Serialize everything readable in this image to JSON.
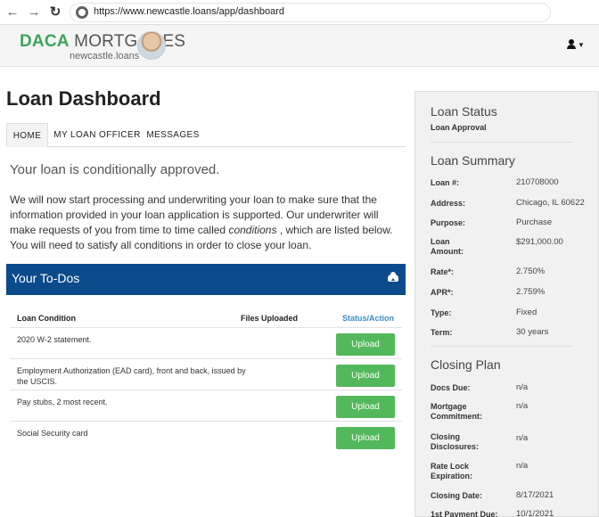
{
  "browser": {
    "url": "https://www.newcastle.loans/app/dashboard"
  },
  "header": {
    "logo_daca": "DACA",
    "logo_mortgages": " MORTGAGES",
    "logo_sub": "newcastle.loans"
  },
  "main": {
    "title": "Loan Dashboard",
    "tabs": [
      "HOME",
      "MY LOAN OFFICER",
      "MESSAGES"
    ],
    "status_line": "Your loan is conditionally approved.",
    "intro_before": "We will now start processing and underwriting your loan to make sure that the information provided in your loan application is supported. Our underwriter will make requests of you from time to time called ",
    "intro_em": "conditions",
    "intro_after": " , which are listed below. You will need to satisfy all conditions in order to close your loan.",
    "todo_title": "Your To-Dos",
    "columns": [
      "Loan Condition",
      "Files Uploaded",
      "Status/Action"
    ],
    "conditions": [
      {
        "text": "2020 W-2 statement.",
        "action": "Upload"
      },
      {
        "text": "Employment Authorization (EAD card), front and back, issued by the USCIS.",
        "action": "Upload"
      },
      {
        "text": "Pay stubs, 2 most recent.",
        "action": "Upload"
      },
      {
        "text": "Social Security card",
        "action": "Upload"
      }
    ]
  },
  "sidebar": {
    "status_heading": "Loan Status",
    "status_value": "Loan Approval",
    "summary_heading": "Loan Summary",
    "summary": [
      {
        "label": "Loan #:",
        "value": "210708000"
      },
      {
        "label": "Address:",
        "value": "Chicago, IL 60622"
      },
      {
        "label": "Purpose:",
        "value": "Purchase"
      },
      {
        "label": "Loan Amount:",
        "value": "$291,000.00"
      },
      {
        "label": "Rate*:",
        "value": "2.750%"
      },
      {
        "label": "APR*:",
        "value": "2.759%"
      },
      {
        "label": "Type:",
        "value": "Fixed"
      },
      {
        "label": "Term:",
        "value": "30 years"
      }
    ],
    "closing_heading": "Closing Plan",
    "closing": [
      {
        "label": "Docs Due:",
        "value": "n/a"
      },
      {
        "label": "Mortgage Commitment:",
        "value": "n/a"
      },
      {
        "label": "Closing Disclosures:",
        "value": "n/a"
      },
      {
        "label": "Rate Lock Expiration:",
        "value": "n/a"
      },
      {
        "label": "Closing Date:",
        "value": "8/17/2021"
      },
      {
        "label": "1st Payment Due:",
        "value": "10/1/2021"
      }
    ]
  }
}
